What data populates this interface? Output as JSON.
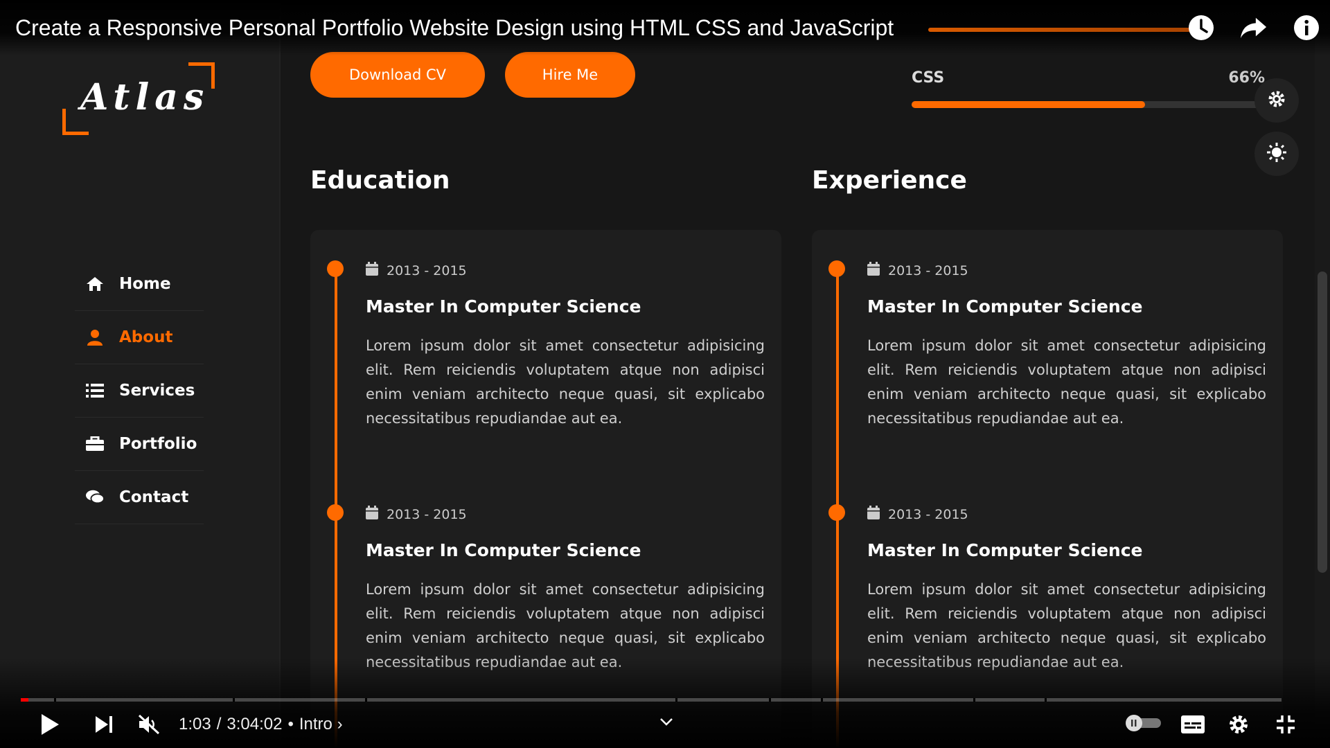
{
  "player": {
    "video_title": "Create a Responsive Personal Portfolio Website Design using HTML CSS and JavaScript",
    "current_time": "1:03",
    "duration": "3:04:02",
    "time_separator": "/",
    "chapter_bullet": "•",
    "chapter": "Intro",
    "chapter_chevron": "›",
    "played_fraction": 0.006,
    "top_icons": [
      "watch-later-icon",
      "share-icon",
      "info-icon"
    ],
    "controls_left": [
      "play-icon",
      "next-icon",
      "mute-icon"
    ],
    "controls_right": [
      "autoplay-toggle-icon",
      "subtitles-icon",
      "settings-icon",
      "exit-fullscreen-icon"
    ]
  },
  "site": {
    "logo": "Atlas",
    "nav": [
      {
        "label": "Home",
        "icon": "home-icon",
        "active": false
      },
      {
        "label": "About",
        "icon": "user-icon",
        "active": true
      },
      {
        "label": "Services",
        "icon": "list-icon",
        "active": false
      },
      {
        "label": "Portfolio",
        "icon": "briefcase-icon",
        "active": false
      },
      {
        "label": "Contact",
        "icon": "chat-icon",
        "active": false
      }
    ],
    "buttons": {
      "download_cv": "Download CV",
      "hire_me": "Hire Me"
    },
    "skill": {
      "name": "CSS",
      "percent_label": "66%",
      "level": 0.66
    },
    "education": {
      "title": "Education",
      "entries": [
        {
          "date": "2013 - 2015",
          "title": "Master In Computer Science",
          "desc": "Lorem ipsum dolor sit amet consectetur adipisicing elit. Rem reiciendis voluptatem atque non adipisci enim veniam architecto neque quasi, sit explicabo necessitatibus repudiandae aut ea."
        },
        {
          "date": "2013 - 2015",
          "title": "Master In Computer Science",
          "desc": "Lorem ipsum dolor sit amet consectetur adipisicing elit. Rem reiciendis voluptatem atque non adipisci enim veniam architecto neque quasi, sit explicabo necessitatibus repudiandae aut ea."
        }
      ]
    },
    "experience": {
      "title": "Experience",
      "entries": [
        {
          "date": "2013 - 2015",
          "title": "Master In Computer Science",
          "desc": "Lorem ipsum dolor sit amet consectetur adipisicing elit. Rem reiciendis voluptatem atque non adipisci enim veniam architecto neque quasi, sit explicabo necessitatibus repudiandae aut ea."
        },
        {
          "date": "2013 - 2015",
          "title": "Master In Computer Science",
          "desc": "Lorem ipsum dolor sit amet consectetur adipisicing elit. Rem reiciendis voluptatem atque non adipisci enim veniam architecto neque quasi, sit explicabo necessitatibus repudiandae aut ea."
        }
      ]
    },
    "accent_color": "#ff6a00"
  }
}
